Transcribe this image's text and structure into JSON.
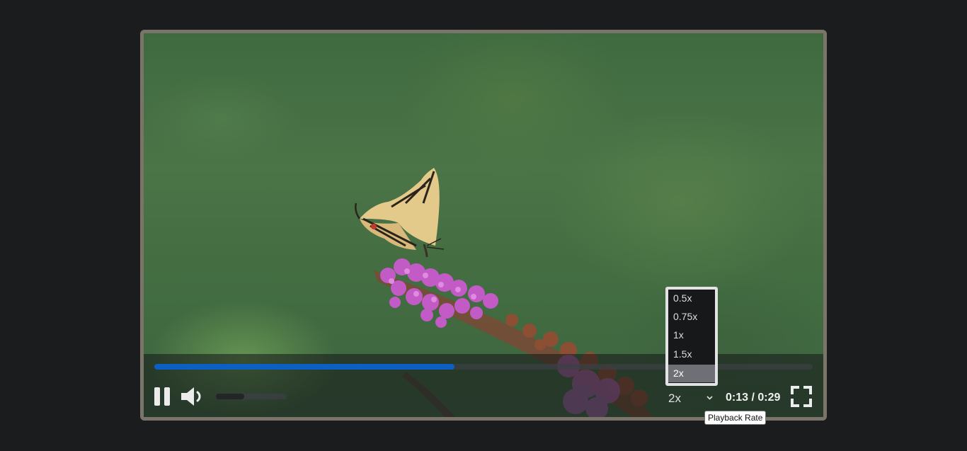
{
  "player": {
    "progress_fraction": 0.456,
    "volume_fraction": 0.4,
    "playback_rate": "2x",
    "current_time": "0:13",
    "duration": "0:29",
    "time_separator": " / ",
    "rate_options": [
      "0.5x",
      "0.75x",
      "1x",
      "1.5x",
      "2x"
    ],
    "selected_rate_index": 4,
    "tooltip": "Playback Rate"
  },
  "icons": {
    "pause": "pause-icon",
    "volume": "volume-icon",
    "chevron": "chevron-down-icon",
    "fullscreen": "fullscreen-icon"
  },
  "colors": {
    "page_background": "#1b1c1e",
    "frame_border": "#7b7569",
    "progress_fill": "#0d5fc3",
    "menu_selected": "#6f7076"
  }
}
